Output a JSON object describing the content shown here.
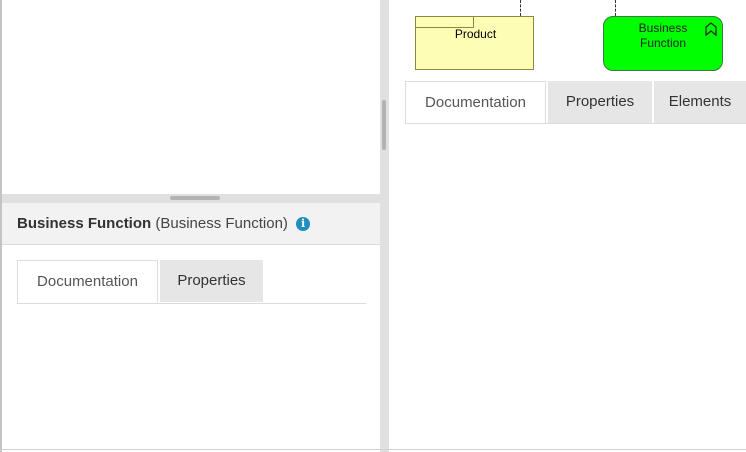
{
  "diagram": {
    "product_label": "Product",
    "business_function_label_line1": "Business",
    "business_function_label_line2": "Function",
    "business_function_fill": "#00ff00",
    "product_fill": "#fefdb5"
  },
  "details": {
    "name": "Business Function",
    "type": "(Business Function)",
    "info_icon": "info-icon",
    "info_icon_glyph": "i",
    "tabs": [
      {
        "label": "Documentation",
        "active": true
      },
      {
        "label": "Properties",
        "active": false
      }
    ]
  },
  "right_panel": {
    "tabs": [
      {
        "label": "Documentation",
        "active": true
      },
      {
        "label": "Properties",
        "active": false
      },
      {
        "label": "Elements",
        "active": false
      }
    ]
  },
  "colors": {
    "accent": "#1f8fbf",
    "splitter": "#e0e0e0"
  }
}
